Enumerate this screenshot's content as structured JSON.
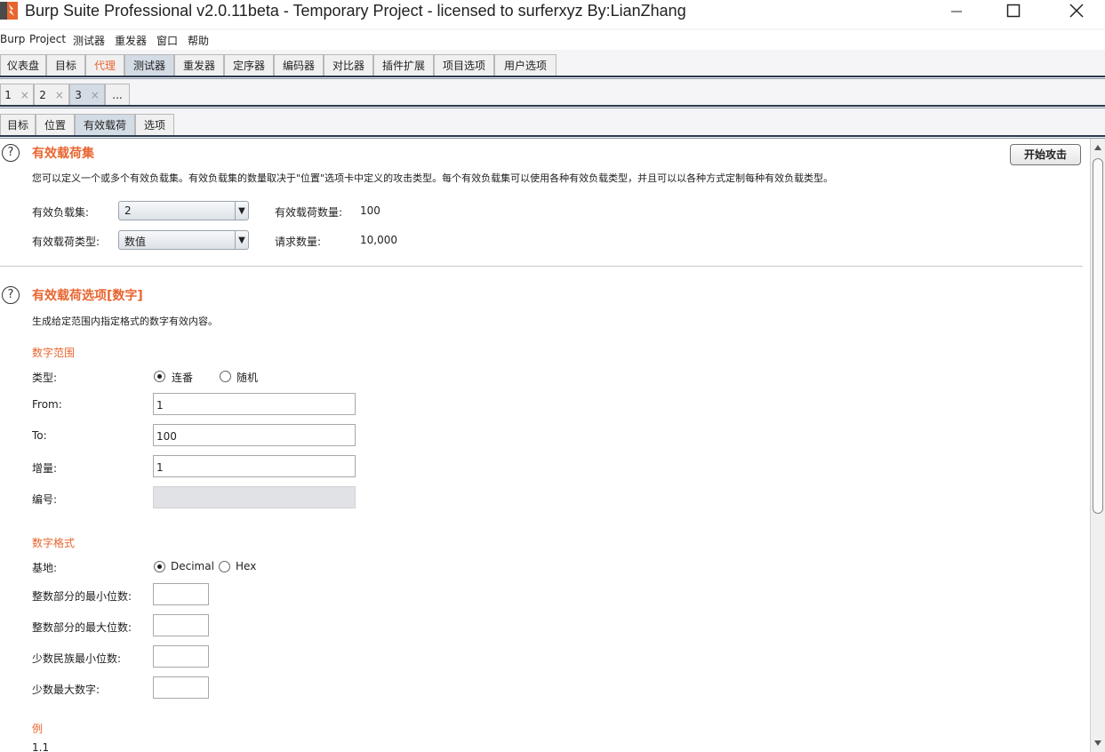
{
  "window": {
    "title": "Burp Suite Professional v2.0.11beta - Temporary Project - licensed to surferxyz By:LianZhang"
  },
  "menu": [
    "Burp",
    "Project",
    "测试器",
    "重发器",
    "窗口",
    "帮助"
  ],
  "main_tabs": [
    "仪表盘",
    "目标",
    "代理",
    "测试器",
    "重发器",
    "定序器",
    "编码器",
    "对比器",
    "插件扩展",
    "项目选项",
    "用户选项"
  ],
  "intruder_tabs": [
    {
      "label": "1",
      "close": "×"
    },
    {
      "label": "2",
      "close": "×"
    },
    {
      "label": "3",
      "close": "×"
    },
    {
      "label": "...",
      "close": ""
    }
  ],
  "sub_tabs": [
    "目标",
    "位置",
    "有效载荷",
    "选项"
  ],
  "payload_sets": {
    "title": "有效载荷集",
    "description": "您可以定义一个或多个有效负载集。有效负载集的数量取决于\"位置\"选项卡中定义的攻击类型。每个有效负载集可以使用各种有效负载类型，并且可以以各种方式定制每种有效负载类型。",
    "start_button": "开始攻击",
    "set_label": "有效负载集:",
    "set_value": "2",
    "count_label": "有效载荷数量:",
    "count_value": "100",
    "type_label": "有效载荷类型:",
    "type_value": "数值",
    "requests_label": "请求数量:",
    "requests_value": "10,000"
  },
  "payload_options": {
    "title": "有效载荷选项[数字]",
    "description": "生成给定范围内指定格式的数字有效内容。",
    "range_title": "数字范围",
    "type_label": "类型:",
    "type_options": [
      "连番",
      "随机"
    ],
    "from_label": "From:",
    "from_value": "1",
    "to_label": "To:",
    "to_value": "100",
    "step_label": "增量:",
    "step_value": "1",
    "number_label": "编号:",
    "number_value": "",
    "format_title": "数字格式",
    "base_label": "基地:",
    "base_options": [
      "Decimal",
      "Hex"
    ],
    "min_int_label": "整数部分的最小位数:",
    "max_int_label": "整数部分的最大位数:",
    "min_frac_label": "少数民族最小位数:",
    "max_frac_label": "少数最大数字:",
    "example_title": "例",
    "example_value": "1.1"
  },
  "colors": {
    "accent": "#e8652f",
    "active_tab": "#d3dbe4",
    "divider": "#2a3a4e"
  },
  "icons": [
    "burp-logo-icon",
    "minimize-icon",
    "maximize-icon",
    "close-icon",
    "help-icon",
    "dropdown-arrow-icon"
  ]
}
